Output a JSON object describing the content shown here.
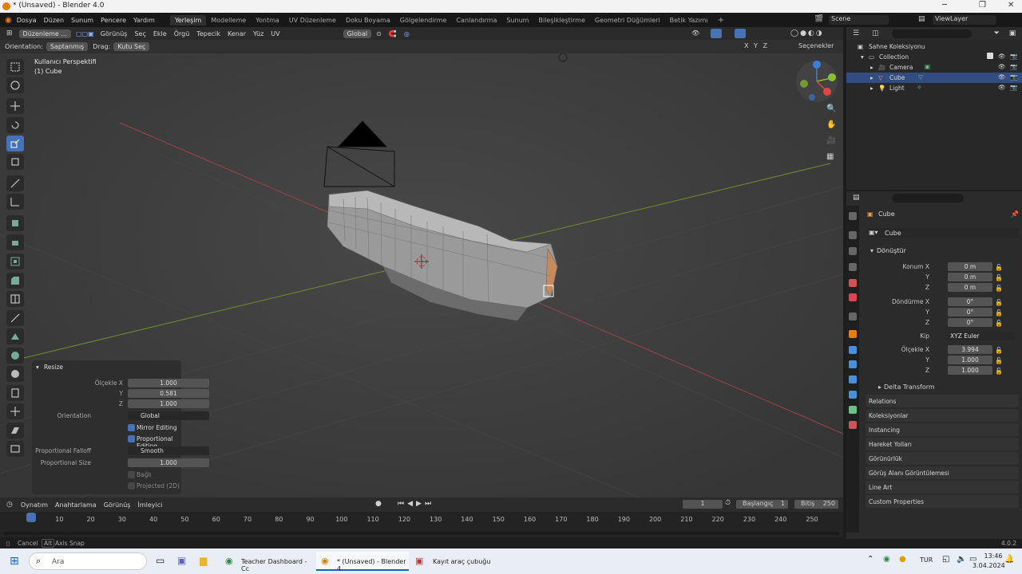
{
  "window": {
    "title": "* (Unsaved) - Blender 4.0"
  },
  "menu": [
    "Dosya",
    "Düzen",
    "Sunum",
    "Pencere",
    "Yardım"
  ],
  "workspaces": [
    "Yerleşim",
    "Modelleme",
    "Yontma",
    "UV Düzenleme",
    "Doku Boyama",
    "Gölgelendirme",
    "Canlandırma",
    "Sunum",
    "Bileşikleştirme",
    "Geometri Düğümleri",
    "Betik Yazımı"
  ],
  "scene": {
    "label": "Scene",
    "view_layer": "ViewLayer"
  },
  "viewport": {
    "mode": "Düzenleme ...",
    "menus": [
      "Görünüş",
      "Seç",
      "Ekle",
      "Örgü",
      "Tepecik",
      "Kenar",
      "Yüz",
      "UV"
    ],
    "transform_orientation": "Global",
    "orientation_label": "Orientation:",
    "orientation_value": "Saptanmış",
    "drag_label": "Drag:",
    "drag_value": "Kutu Seç",
    "options": "Seçenekler",
    "axes": "X Y Z",
    "overlay_view": "Kullanıcı Perspektifi",
    "overlay_object": "(1) Cube"
  },
  "redo_panel": {
    "title": "Resize",
    "scale_x_label": "Ölçekle X",
    "scale_x": "1.000",
    "scale_y_label": "Y",
    "scale_y": "0.581",
    "scale_z_label": "Z",
    "scale_z": "1.000",
    "orientation_label": "Orientation",
    "orientation": "Global",
    "mirror_editing": "Mirror Editing",
    "proportional_editing": "Proportional Editing",
    "falloff_label": "Proportional Falloff",
    "falloff": "Smooth",
    "size_label": "Proportional Size",
    "size": "1.000",
    "connected": "Bağlı",
    "projected": "Projected (2D)"
  },
  "timeline": {
    "menus": [
      "Oynatım",
      "Anahtarlama",
      "Görünüş",
      "İmleyici"
    ],
    "current_frame": "1",
    "start_label": "Başlangıç",
    "start": "1",
    "end_label": "Bitiş",
    "end": "250",
    "ruler": [
      "1",
      "10",
      "20",
      "30",
      "40",
      "50",
      "60",
      "70",
      "80",
      "90",
      "100",
      "110",
      "120",
      "130",
      "140",
      "150",
      "160",
      "170",
      "180",
      "190",
      "200",
      "210",
      "220",
      "230",
      "240",
      "250"
    ]
  },
  "status": {
    "cancel": "Cancel",
    "alt": "Alt",
    "axis_snap": "Axis Snap",
    "version": "4.0.2"
  },
  "outliner": {
    "root": "Sahne Koleksiyonu",
    "collection": "Collection",
    "items": [
      "Camera",
      "Cube",
      "Light"
    ]
  },
  "properties": {
    "object_name": "Cube",
    "data_name": "Cube",
    "transform_title": "Dönüştür",
    "location_label": "Konum X",
    "location": [
      "0 m",
      "0 m",
      "0 m"
    ],
    "rotation_label": "Döndürme X",
    "rotation": [
      "0°",
      "0°",
      "0°"
    ],
    "mode_label": "Kip",
    "mode": "XYZ Euler",
    "scale_label": "Ölçekle X",
    "scale": [
      "3.994",
      "1.000",
      "1.000"
    ],
    "y_label": "Y",
    "z_label": "Z",
    "delta": "Delta Transform",
    "sections": [
      "Relations",
      "Koleksiyonlar",
      "Instancing",
      "Hareket Yolları",
      "Görünürlük",
      "Görüş Alanı Görüntülemesi",
      "Line Art",
      "Custom Properties"
    ]
  },
  "taskbar": {
    "search": "Ara",
    "apps": [
      "Teacher Dashboard - Cc",
      "* (Unsaved) - Blender 4.",
      "Kayıt araç çubuğu"
    ],
    "lang": "TUR",
    "time": "13:46",
    "date": "3.04.2024"
  },
  "colors": {
    "accent": "#4772b3",
    "selection": "#334d80",
    "viewport_bg": "#3d3d3d",
    "blender_orange": "#e87d0d"
  }
}
